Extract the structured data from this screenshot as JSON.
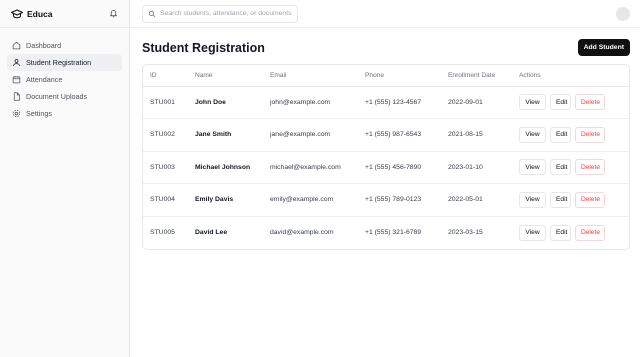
{
  "app": {
    "name": "Educa"
  },
  "search": {
    "placeholder": "Search students, attendance, or documents..."
  },
  "sidebar": {
    "items": [
      {
        "label": "Dashboard",
        "icon": "home-icon",
        "active": false
      },
      {
        "label": "Student Registration",
        "icon": "user-icon",
        "active": true
      },
      {
        "label": "Attendance",
        "icon": "calendar-icon",
        "active": false
      },
      {
        "label": "Document Uploads",
        "icon": "document-icon",
        "active": false
      },
      {
        "label": "Settings",
        "icon": "gear-icon",
        "active": false
      }
    ]
  },
  "main": {
    "title": "Student Registration",
    "add_button": "Add Student",
    "table": {
      "headers": [
        "ID",
        "Name",
        "Email",
        "Phone",
        "Enrollment Date",
        "Actions"
      ],
      "rows": [
        {
          "id": "STU001",
          "name": "John Doe",
          "email": "john@example.com",
          "phone": "+1 (555) 123-4567",
          "date": "2022-09-01"
        },
        {
          "id": "STU002",
          "name": "Jane Smith",
          "email": "jane@example.com",
          "phone": "+1 (555) 987-6543",
          "date": "2021-08-15"
        },
        {
          "id": "STU003",
          "name": "Michael Johnson",
          "email": "michael@example.com",
          "phone": "+1 (555) 456-7890",
          "date": "2023-01-10"
        },
        {
          "id": "STU004",
          "name": "Emily Davis",
          "email": "emily@example.com",
          "phone": "+1 (555) 789-0123",
          "date": "2022-05-01"
        },
        {
          "id": "STU005",
          "name": "David Lee",
          "email": "david@example.com",
          "phone": "+1 (555) 321-6789",
          "date": "2023-03-15"
        }
      ],
      "actions": {
        "view": "View",
        "edit": "Edit",
        "delete": "Delete"
      }
    }
  },
  "colors": {
    "accent": "#111111",
    "danger": "#ef4444",
    "active_bg": "#eef0f3"
  }
}
